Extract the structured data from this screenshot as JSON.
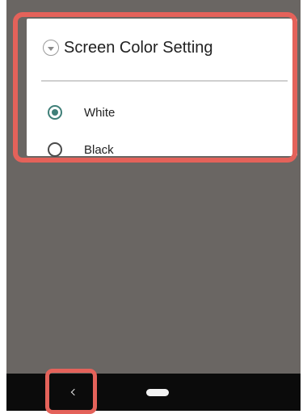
{
  "dialog": {
    "title": "Screen Color Setting",
    "collapse_icon": "chevron-down-circle-icon",
    "options": [
      {
        "label": "White",
        "selected": true
      },
      {
        "label": "Black",
        "selected": false
      }
    ]
  },
  "navbar": {
    "back_icon": "back-chevron-icon",
    "home_icon": "home-pill-icon"
  },
  "colors": {
    "accent": "#3f7f78",
    "highlight": "#e4625a",
    "screen_background": "#6a6663",
    "navbar_background": "#0b0b0b"
  }
}
